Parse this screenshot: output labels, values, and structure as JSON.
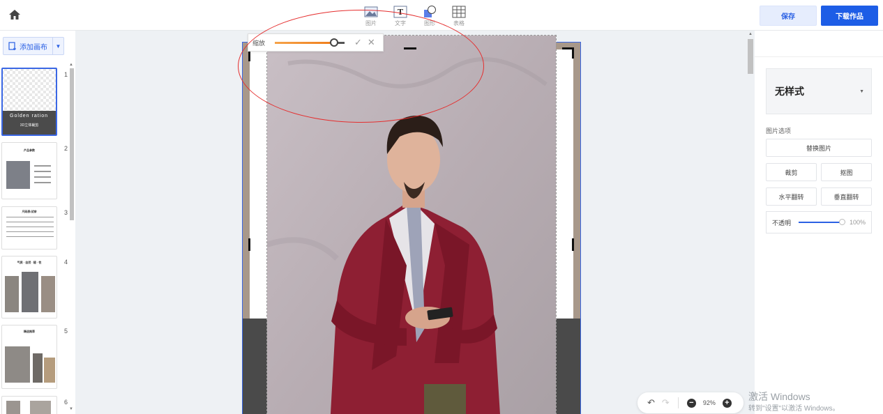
{
  "toolbar": {
    "tools": [
      {
        "label": "图片",
        "icon": "image-icon"
      },
      {
        "label": "文字",
        "icon": "text-icon"
      },
      {
        "label": "图形",
        "icon": "shape-icon"
      },
      {
        "label": "表格",
        "icon": "table-icon"
      }
    ],
    "save_label": "保存",
    "download_label": "下载作品"
  },
  "left_panel": {
    "add_canvas_label": "添加画布",
    "pages": [
      {
        "num": "1",
        "title": "Golden ration",
        "subtitle": "3D立体裁剪",
        "active": true
      },
      {
        "num": "2",
        "title": "产品参数"
      },
      {
        "num": "3",
        "title": "尺码表/试穿"
      },
      {
        "num": "4",
        "title": "气质 · 自然 · 随 · 性"
      },
      {
        "num": "5",
        "title": "精选推荐"
      },
      {
        "num": "6",
        "title": ""
      }
    ]
  },
  "zoom_popup": {
    "label": "缩放",
    "value": 0.85
  },
  "history_bar": {
    "zoom_value": "92%"
  },
  "right_panel": {
    "style_name": "无样式",
    "section_title": "图片选项",
    "replace_label": "替换图片",
    "crop_label": "裁剪",
    "matting_label": "抠图",
    "flip_h_label": "水平翻转",
    "flip_v_label": "垂直翻转",
    "opacity_label": "不透明",
    "opacity_value": 1.0,
    "opacity_text": "100%"
  },
  "watermark": {
    "line1": "激活 Windows",
    "line2": "转到\"设置\"以激活 Windows。"
  },
  "colors": {
    "accent": "#1d5de6",
    "annotation": "#e52e2e",
    "slider_orange": "#f07d1a"
  }
}
